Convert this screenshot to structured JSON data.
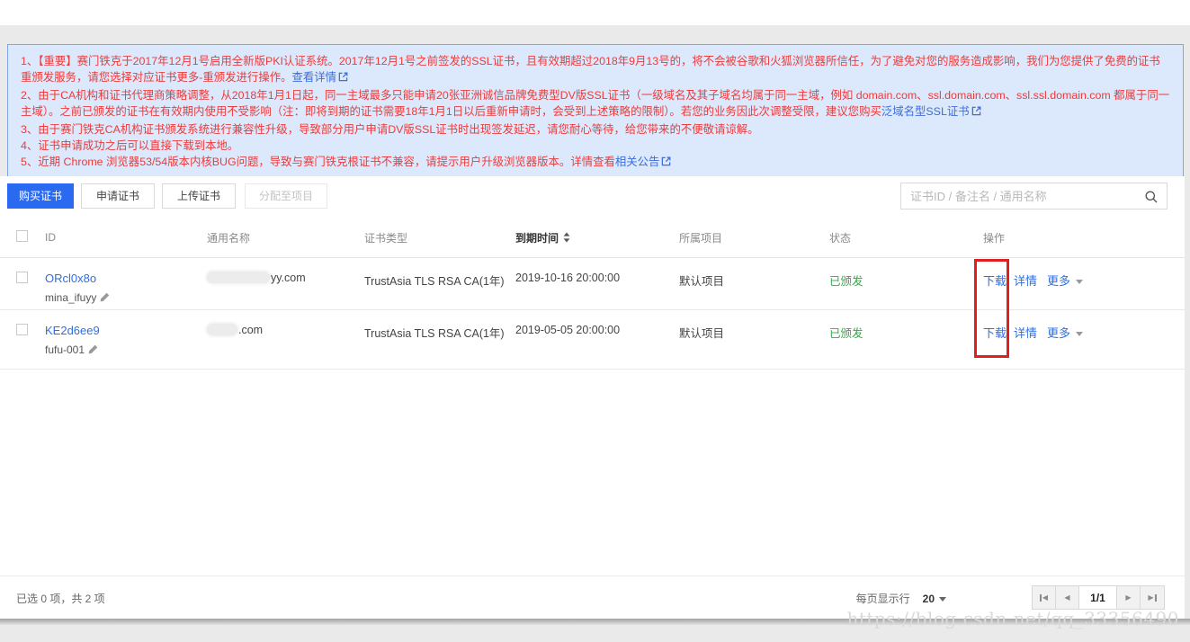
{
  "notice": {
    "line1": {
      "text": "1、【重要】赛门铁克于2017年12月1号启用全新版PKI认证系统。2017年12月1号之前签发的SSL证书，且有效期超过2018年9月13号的，将不会被谷歌和火狐浏览器所信任，为了避免对您的服务造成影响，我们为您提供了免费的证书重颁发服务，请您选择对应证书更多-重颁发进行操作。",
      "link": "查看详情"
    },
    "line2": {
      "text": "2、由于CA机构和证书代理商策略调整，从2018年1月1日起，同一主域最多只能申请20张亚洲诚信品牌免费型DV版SSL证书（一级域名及其子域名均属于同一主域，例如 domain.com、ssl.domain.com、ssl.ssl.domain.com 都属于同一主域）。之前已颁发的证书在有效期内使用不受影响（注：即将到期的证书需要18年1月1日以后重新申请时，会受到上述策略的限制）。若您的业务因此次调整受限，建议您购买",
      "link": "泛域名型SSL证书"
    },
    "line3": {
      "text": "3、由于赛门铁克CA机构证书颁发系统进行兼容性升级，导致部分用户申请DV版SSL证书时出现签发延迟，请您耐心等待，给您带来的不便敬请谅解。"
    },
    "line4": {
      "text": "4、证书申请成功之后可以直接下载到本地。"
    },
    "line5": {
      "text": "5、近期 Chrome 浏览器53/54版本内核BUG问题，导致与赛门铁克根证书不兼容，请提示用户升级浏览器版本。详情查看",
      "link": "相关公告"
    }
  },
  "toolbar": {
    "buy": "购买证书",
    "apply": "申请证书",
    "upload": "上传证书",
    "assign": "分配至项目",
    "search_placeholder": "证书ID / 备注名 / 通用名称"
  },
  "table": {
    "headers": {
      "id": "ID",
      "common_name": "通用名称",
      "cert_type": "证书类型",
      "expire_time": "到期时间",
      "project": "所属项目",
      "status": "状态",
      "operation": "操作"
    },
    "rows": [
      {
        "id": "ORcl0x8o",
        "remark": "mina_ifuyy",
        "common_name_visible": "yy.com",
        "cert_type": "TrustAsia TLS RSA CA(1年)",
        "expire_time": "2019-10-16 20:00:00",
        "project": "默认项目",
        "status": "已颁发",
        "actions": {
          "download": "下载",
          "detail": "详情",
          "more": "更多"
        }
      },
      {
        "id": "KE2d6ee9",
        "remark": "fufu-001",
        "common_name_visible": ".com",
        "cert_type": "TrustAsia TLS RSA CA(1年)",
        "expire_time": "2019-05-05 20:00:00",
        "project": "默认项目",
        "status": "已颁发",
        "actions": {
          "download": "下载",
          "detail": "详情",
          "more": "更多"
        }
      }
    ]
  },
  "footer": {
    "selection": "已选 0 项，共 2 项",
    "per_page_label": "每页显示行",
    "per_page": "20",
    "page_indicator": "1/1"
  },
  "watermark": "https://blog.csdn.net/qq_33356490",
  "colors": {
    "accent_blue": "#2a6af0",
    "link_blue": "#2f6fe0",
    "notice_red": "#ec3b3b",
    "notice_bg": "#dce8fb",
    "notice_border": "#7da7e8",
    "status_green": "#2fab43",
    "annotation_red": "#e02020"
  }
}
